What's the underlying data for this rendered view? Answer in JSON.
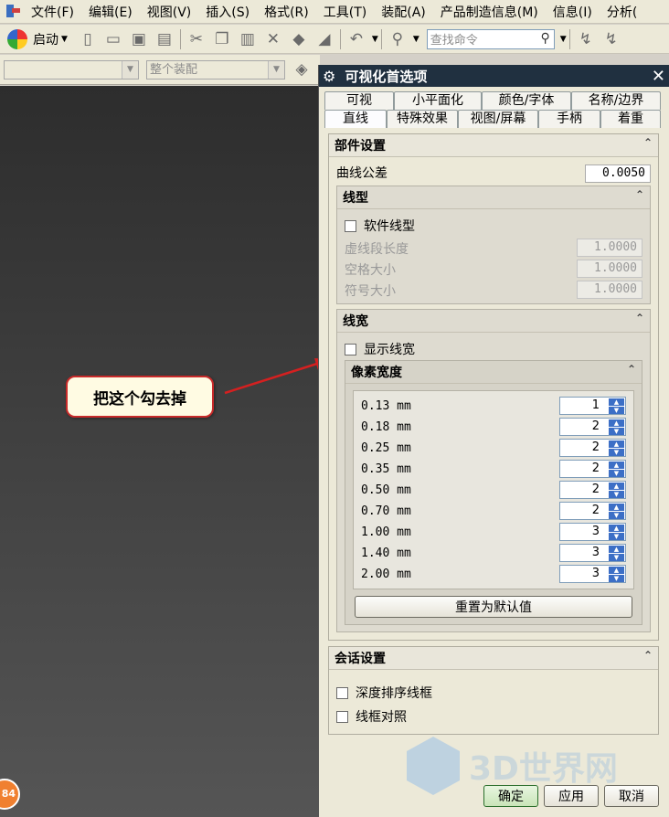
{
  "menubar": {
    "items": [
      "文件(F)",
      "编辑(E)",
      "视图(V)",
      "插入(S)",
      "格式(R)",
      "工具(T)",
      "装配(A)",
      "产品制造信息(M)",
      "信息(I)",
      "分析("
    ]
  },
  "toolbar": {
    "start_label": "启动",
    "search_placeholder": "查找命令"
  },
  "toolbar2": {
    "filter_combo": "",
    "assembly_combo": "整个装配"
  },
  "callout": {
    "text": "把这个勾去掉"
  },
  "dialog": {
    "title": "可视化首选项",
    "tabs_row1": [
      "可视",
      "小平面化",
      "颜色/字体",
      "名称/边界"
    ],
    "tabs_row2": [
      "直线",
      "特殊效果",
      "视图/屏幕",
      "手柄",
      "着重"
    ],
    "active_tab": "直线",
    "part_settings": {
      "title": "部件设置",
      "curve_tolerance_label": "曲线公差",
      "curve_tolerance_value": "0.0050",
      "linetype": {
        "title": "线型",
        "software_linetype_label": "软件线型",
        "dash_length_label": "虚线段长度",
        "dash_length_value": "1.0000",
        "space_size_label": "空格大小",
        "space_size_value": "1.0000",
        "symbol_size_label": "符号大小",
        "symbol_size_value": "1.0000"
      },
      "linewidth": {
        "title": "线宽",
        "show_linewidth_label": "显示线宽",
        "pixel_width": {
          "title": "像素宽度",
          "rows": [
            {
              "label": "0.13 mm",
              "value": "1"
            },
            {
              "label": "0.18 mm",
              "value": "2"
            },
            {
              "label": "0.25 mm",
              "value": "2"
            },
            {
              "label": "0.35 mm",
              "value": "2"
            },
            {
              "label": "0.50 mm",
              "value": "2"
            },
            {
              "label": "0.70 mm",
              "value": "2"
            },
            {
              "label": "1.00 mm",
              "value": "3"
            },
            {
              "label": "1.40 mm",
              "value": "3"
            },
            {
              "label": "2.00 mm",
              "value": "3"
            }
          ],
          "reset_label": "重置为默认值"
        }
      }
    },
    "session_settings": {
      "title": "会话设置",
      "depth_sort_label": "深度排序线框",
      "wireframe_compare_label": "线框对照"
    },
    "buttons": {
      "ok": "确定",
      "apply": "应用",
      "cancel": "取消"
    }
  },
  "watermark": {
    "text": "3D世界网"
  },
  "badge": {
    "text": "84"
  }
}
